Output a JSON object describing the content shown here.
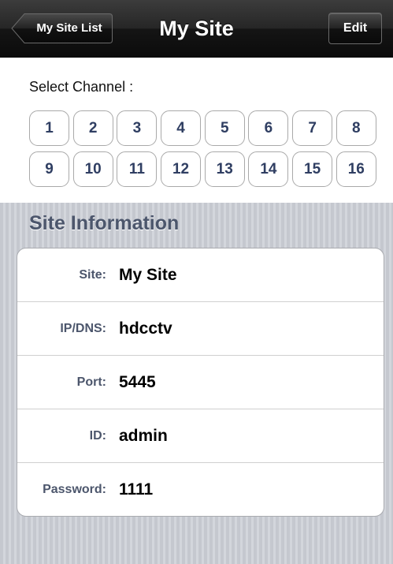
{
  "navbar": {
    "title": "My Site",
    "back_label": "My Site List",
    "edit_label": "Edit"
  },
  "channel": {
    "label": "Select Channel :",
    "buttons": [
      "1",
      "2",
      "3",
      "4",
      "5",
      "6",
      "7",
      "8",
      "9",
      "10",
      "11",
      "12",
      "13",
      "14",
      "15",
      "16"
    ]
  },
  "site_info": {
    "title": "Site Information",
    "rows": [
      {
        "key": "Site:",
        "value": "My Site"
      },
      {
        "key": "IP/DNS:",
        "value": "hdcctv"
      },
      {
        "key": "Port:",
        "value": "5445"
      },
      {
        "key": "ID:",
        "value": "admin"
      },
      {
        "key": "Password:",
        "value": "1111"
      }
    ]
  }
}
